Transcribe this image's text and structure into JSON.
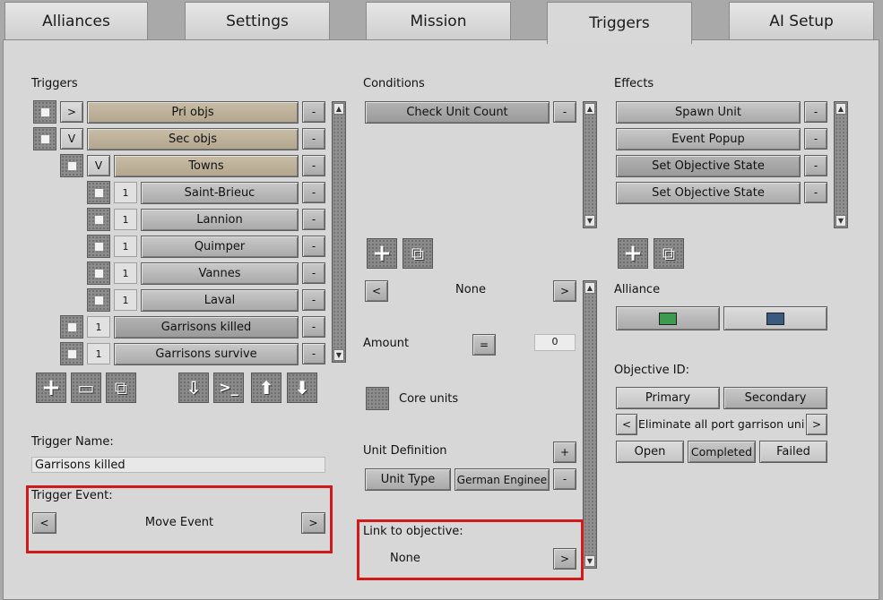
{
  "tabs": [
    "Alliances",
    "Settings",
    "Mission",
    "Triggers",
    "AI Setup"
  ],
  "triggers": {
    "heading": "Triggers",
    "items": [
      {
        "toggle": ">",
        "label": "Pri objs",
        "remove": "-"
      },
      {
        "toggle": "V",
        "label": "Sec objs",
        "remove": "-"
      },
      {
        "toggle": "V",
        "label": "Towns",
        "remove": "-"
      },
      {
        "toggle": "1",
        "label": "Saint-Brieuc",
        "remove": "-"
      },
      {
        "toggle": "1",
        "label": "Lannion",
        "remove": "-"
      },
      {
        "toggle": "1",
        "label": "Quimper",
        "remove": "-"
      },
      {
        "toggle": "1",
        "label": "Vannes",
        "remove": "-"
      },
      {
        "toggle": "1",
        "label": "Laval",
        "remove": "-"
      },
      {
        "toggle": "1",
        "label": "Garrisons killed",
        "remove": "-"
      },
      {
        "toggle": "1",
        "label": "Garrisons survive",
        "remove": "-"
      }
    ],
    "name_label": "Trigger Name:",
    "name_value": "Garrisons killed",
    "event_label": "Trigger Event:",
    "event_prev": "<",
    "event_value": "Move Event",
    "event_next": ">"
  },
  "conditions": {
    "heading": "Conditions",
    "items": [
      {
        "label": "Check Unit Count",
        "remove": "-"
      }
    ],
    "selector_prev": "<",
    "selector_value": "None",
    "selector_next": ">",
    "amount_label": "Amount",
    "amount_op": "=",
    "amount_value": "0",
    "core_units_label": "Core units",
    "unit_def_label": "Unit Definition",
    "unit_def_add": "+",
    "unit_type_label": "Unit Type",
    "unit_value": "German Enginee",
    "unit_remove": "-",
    "link_label": "Link to objective:",
    "link_value": "None",
    "link_next": ">"
  },
  "effects": {
    "heading": "Effects",
    "items": [
      {
        "label": "Spawn Unit",
        "remove": "-"
      },
      {
        "label": "Event Popup",
        "remove": "-"
      },
      {
        "label": "Set Objective State",
        "remove": "-"
      },
      {
        "label": "Set Objective State",
        "remove": "-"
      }
    ],
    "alliance_label": "Alliance",
    "alliance_colors": [
      "#3e9a4e",
      "#3a5a80"
    ],
    "objective_id_label": "Objective ID:",
    "primary_label": "Primary",
    "secondary_label": "Secondary",
    "objective_prev": "<",
    "objective_value": "Eliminate all port garrison units",
    "objective_next": ">",
    "state_open": "Open",
    "state_completed": "Completed",
    "state_failed": "Failed"
  },
  "icons": {
    "add": "+",
    "folder": "▭",
    "copy": "⧉",
    "import": "⇩",
    "console": ">_",
    "move_up": "⬆",
    "move_down": "⬇"
  }
}
